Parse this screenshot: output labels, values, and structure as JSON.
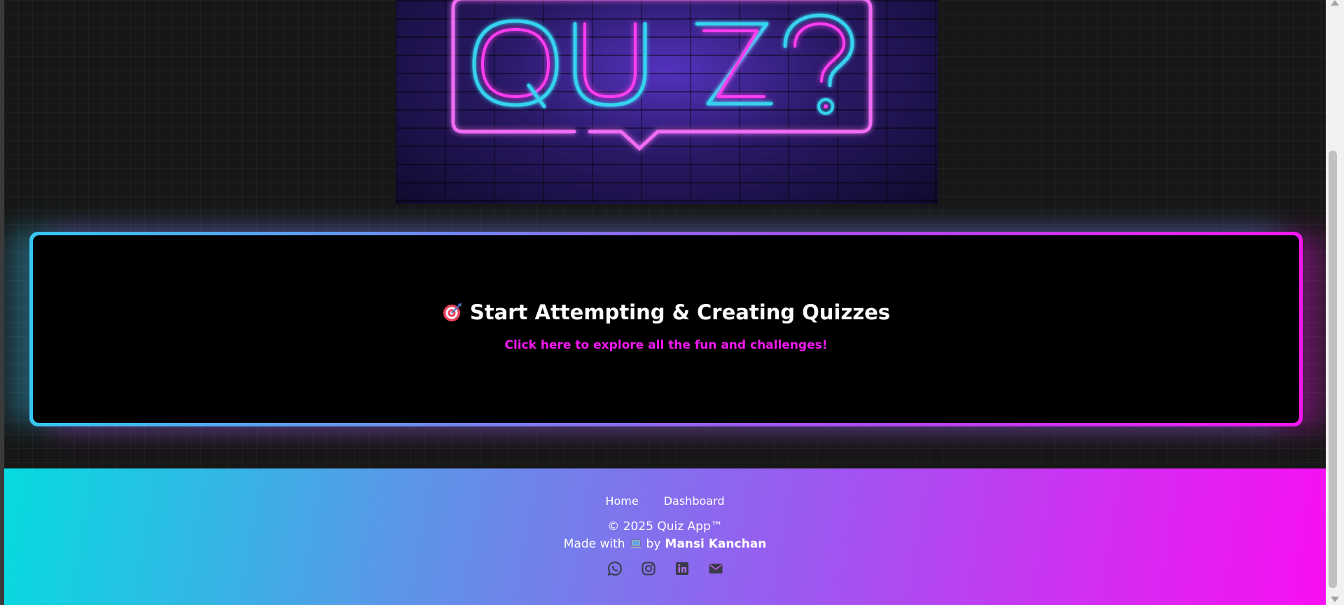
{
  "hero": {
    "sign_text": "QUIZ?"
  },
  "cta": {
    "icon": "target-icon",
    "title": "Start Attempting & Creating Quizzes",
    "subtitle": "Click here to explore all the fun and challenges!"
  },
  "footer": {
    "nav": [
      {
        "label": "Home"
      },
      {
        "label": "Dashboard"
      }
    ],
    "copyright": "© 2025 Quiz App™",
    "made_with_prefix": "Made with",
    "made_with_icon": "laptop-icon",
    "made_with_by": "by",
    "author": "Mansi Kanchan",
    "socials": [
      "whatsapp-icon",
      "instagram-icon",
      "linkedin-icon",
      "email-icon"
    ]
  },
  "colors": {
    "accent_cyan": "#36c6f0",
    "accent_magenta": "#f318f0",
    "footer_start": "#06dbe0",
    "footer_end": "#f80ef2"
  }
}
